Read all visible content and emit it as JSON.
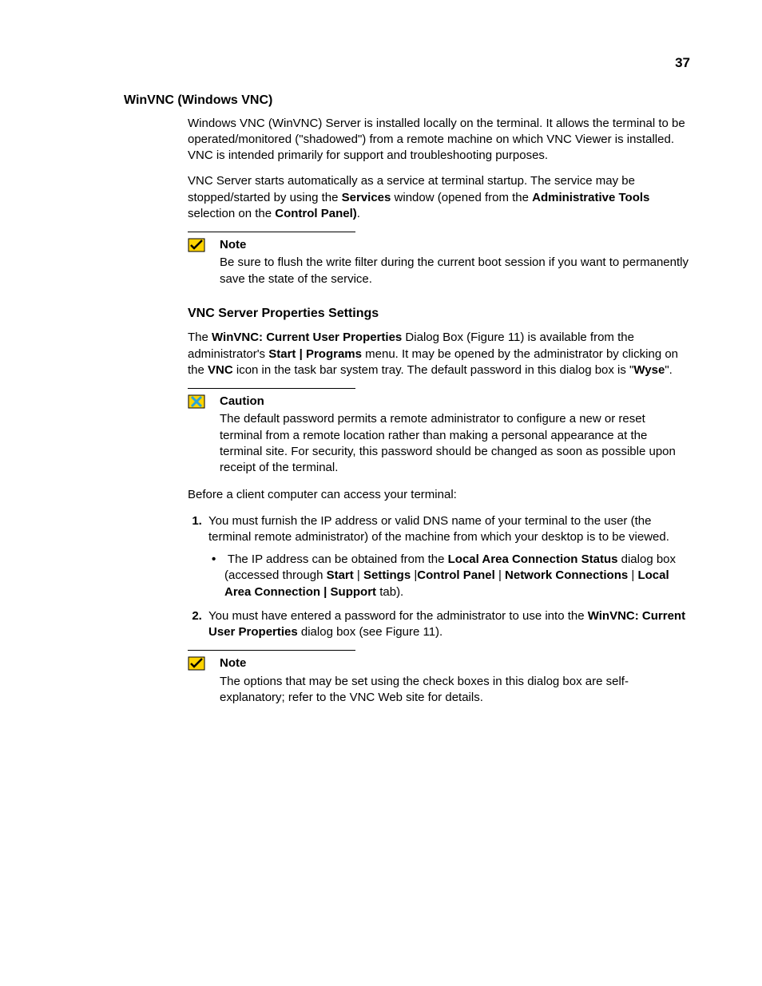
{
  "page_number": "37",
  "section1": {
    "title": "WinVNC (Windows VNC)",
    "p1": "Windows VNC (WinVNC) Server is installed locally on the terminal. It allows the terminal to be operated/monitored (\"shadowed\") from a remote machine on which VNC Viewer is installed. VNC is intended primarily for support and troubleshooting purposes.",
    "p2_pre": "VNC Server starts automatically as a service at terminal startup. The service may be stopped/started by using the ",
    "p2_b1": "Services",
    "p2_mid": " window (opened from the ",
    "p2_b2": "Administrative Tools",
    "p2_mid2": " selection on the ",
    "p2_b3": "Control Panel)",
    "p2_end": "."
  },
  "note1": {
    "label": "Note",
    "body": "Be sure to flush the write filter during the current boot session if you want to permanently save the state of the service."
  },
  "section2": {
    "title": "VNC Server Properties Settings",
    "p1_a": "The ",
    "p1_b1": "WinVNC: Current User Properties",
    "p1_b": " Dialog Box (Figure 11) is available from the administrator's ",
    "p1_b2": "Start | Programs",
    "p1_c": " menu. It may be opened by the administrator by clicking on the ",
    "p1_b3": "VNC",
    "p1_d": " icon in the task bar system tray. The default password in this dialog box is \"",
    "p1_b4": "Wyse",
    "p1_e": "\"."
  },
  "caution": {
    "label": "Caution",
    "body": "The default password permits a remote administrator to configure a new or reset terminal from a remote location rather than making a personal appearance at the terminal site. For security, this password should be changed as soon as possible upon receipt of the terminal."
  },
  "before_text": "Before a client computer can access your terminal:",
  "list": {
    "item1": "You must furnish the IP address or valid DNS name of your terminal to the user (the terminal remote administrator) of the machine from which your desktop is to be viewed.",
    "sub_a": "The IP address can be obtained from the ",
    "sub_b1": "Local Area Connection Status",
    "sub_b": " dialog box (accessed through ",
    "sub_b2": "Start",
    "sub_sep": " | ",
    "sub_b3": "Settings",
    "sub_sep2": " |",
    "sub_b4": "Control Panel",
    "sub_b5": "Network Connections",
    "sub_b6": "Local Area Connection | Support",
    "sub_end": " tab).",
    "item2_a": "You must have entered a password for the administrator to use into the ",
    "item2_b1": "WinVNC: Current User Properties",
    "item2_b": " dialog box (see Figure 11)."
  },
  "note2": {
    "label": "Note",
    "body": "The options that may be set using the check boxes in this dialog box are self-explanatory; refer to the VNC Web site for details."
  }
}
